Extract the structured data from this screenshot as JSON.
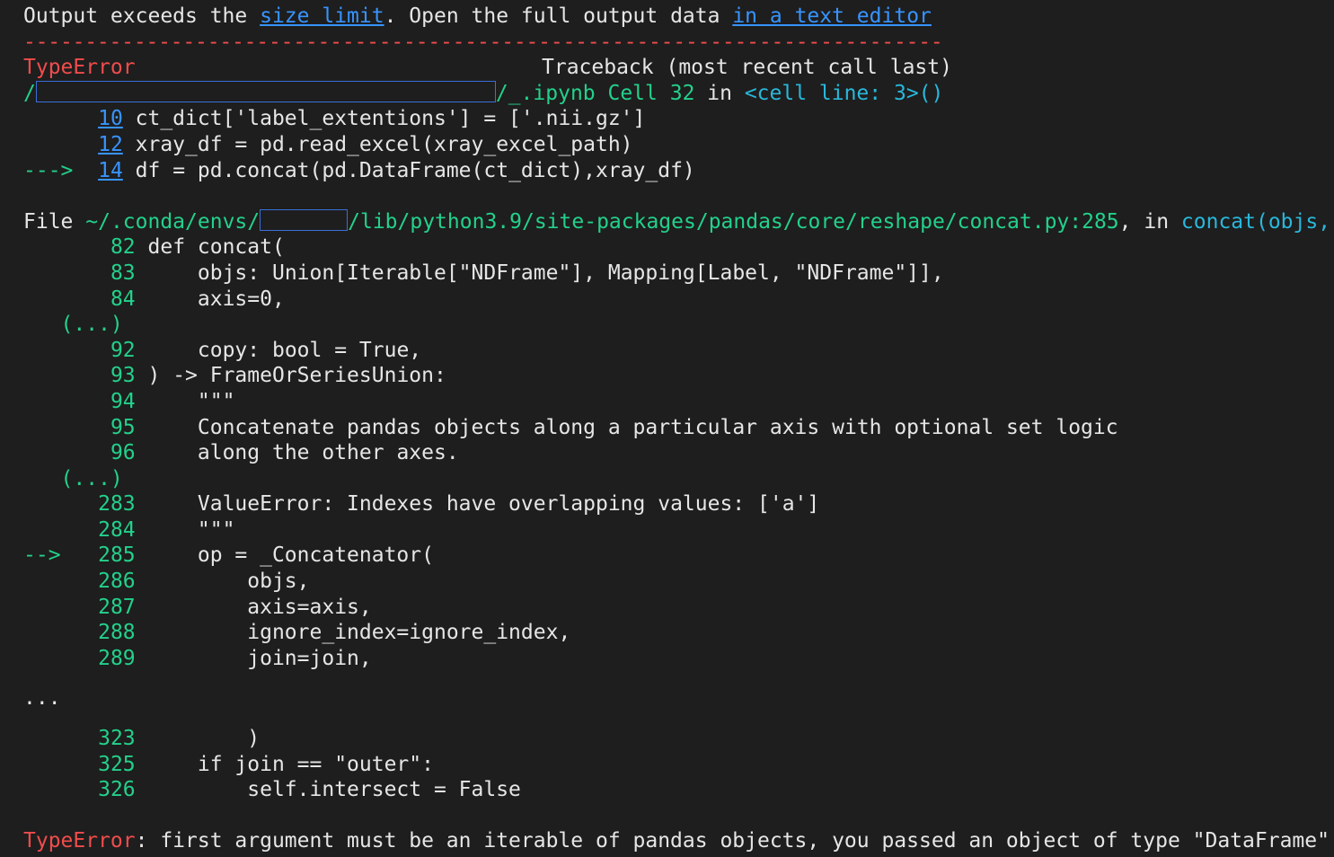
{
  "notice": {
    "prefix": "Output exceeds the ",
    "size_limit_link": "size limit",
    "middle": ". Open the full output data ",
    "editor_link": "in a text editor"
  },
  "dashes": "---------------------------------------------------------------------------",
  "error_header": {
    "type": "TypeError",
    "traceback": "Traceback (most recent call last)"
  },
  "cell_location": {
    "leading": "/",
    "suffix": "/_.ipynb Cell 32",
    "in_word": " in ",
    "func": "<cell line: 3>()"
  },
  "cell_lines": [
    {
      "arrow": "    ",
      "num": "10",
      "code": " ct_dict['label_extentions'] = ['.nii.gz']"
    },
    {
      "arrow": "    ",
      "num": "12",
      "code": " xray_df = pd.read_excel(xray_excel_path)"
    },
    {
      "arrow": "---> ",
      "num": "14",
      "code": " df = pd.concat(pd.DataFrame(ct_dict),xray_df)"
    }
  ],
  "file_location": {
    "file_word": "File ",
    "path_prefix": "~/.conda/envs/",
    "path_suffix": "/lib/python3.9/site-packages/pandas/core/reshape/concat.py:285",
    "in_word": ", in ",
    "func": "concat(objs,"
  },
  "source_lines": [
    {
      "arrow": "     ",
      "num": "82",
      "code": " def concat("
    },
    {
      "arrow": "     ",
      "num": "83",
      "code": "     objs: Union[Iterable[\"NDFrame\"], Mapping[Label, \"NDFrame\"]],"
    },
    {
      "arrow": "     ",
      "num": "84",
      "code": "     axis=0,"
    },
    {
      "arrow": "   ",
      "num": "(...)",
      "code": ""
    },
    {
      "arrow": "     ",
      "num": "92",
      "code": "     copy: bool = True,"
    },
    {
      "arrow": "     ",
      "num": "93",
      "code": " ) -> FrameOrSeriesUnion:"
    },
    {
      "arrow": "     ",
      "num": "94",
      "code": "     \"\"\""
    },
    {
      "arrow": "     ",
      "num": "95",
      "code": "     Concatenate pandas objects along a particular axis with optional set logic"
    },
    {
      "arrow": "     ",
      "num": "96",
      "code": "     along the other axes."
    },
    {
      "arrow": "   ",
      "num": "(...)",
      "code": ""
    },
    {
      "arrow": "    ",
      "num": "283",
      "code": "     ValueError: Indexes have overlapping values: ['a']"
    },
    {
      "arrow": "    ",
      "num": "284",
      "code": "     \"\"\""
    },
    {
      "arrow": "--> ",
      "num": "285",
      "code": "     op = _Concatenator("
    },
    {
      "arrow": "    ",
      "num": "286",
      "code": "         objs,"
    },
    {
      "arrow": "    ",
      "num": "287",
      "code": "         axis=axis,"
    },
    {
      "arrow": "    ",
      "num": "288",
      "code": "         ignore_index=ignore_index,"
    },
    {
      "arrow": "    ",
      "num": "289",
      "code": "         join=join,"
    }
  ],
  "ellipsis": "...",
  "tail_lines": [
    {
      "arrow": "    ",
      "num": "323",
      "code": "         )"
    },
    {
      "arrow": "    ",
      "num": "325",
      "code": "     if join == \"outer\":"
    },
    {
      "arrow": "    ",
      "num": "326",
      "code": "         self.intersect = False"
    }
  ],
  "final_error": {
    "type": "TypeError",
    "message": ": first argument must be an iterable of pandas objects, you passed an object of type \"DataFrame\""
  },
  "colors": {
    "background": "#1e1e1e",
    "link": "#3794ff",
    "error_red": "#f14c4c",
    "green": "#23d18b",
    "cyan": "#29b8db"
  }
}
